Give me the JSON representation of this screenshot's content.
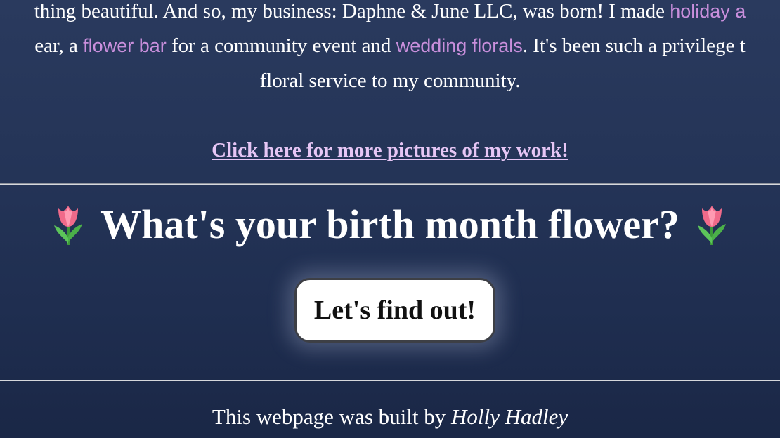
{
  "story": {
    "line1": {
      "text_a": "thing beautiful. And so, my business: Daphne & June LLC, was born! I made ",
      "link_holiday": "holiday a"
    },
    "line2": {
      "text_a": "ear, a ",
      "link_flower_bar": "flower bar",
      "text_b": " for a community event and ",
      "link_wedding": "wedding florals",
      "text_c": ". It's been such a privilege t"
    },
    "line3": "floral service to my community.",
    "more_link": "Click here for more pictures of my work!"
  },
  "quiz": {
    "heading": "What's your birth month flower?",
    "emoji_icon": "tulip-icon",
    "button_label": "Let's find out!"
  },
  "footer": {
    "prefix": "This webpage was built by ",
    "author": "Holly Hadley"
  },
  "colors": {
    "background_top": "#2a3a5e",
    "background_bottom": "#1a2746",
    "inline_link": "#c98fdc",
    "more_link": "#e6c6f5",
    "button_bg": "#ffffff"
  }
}
